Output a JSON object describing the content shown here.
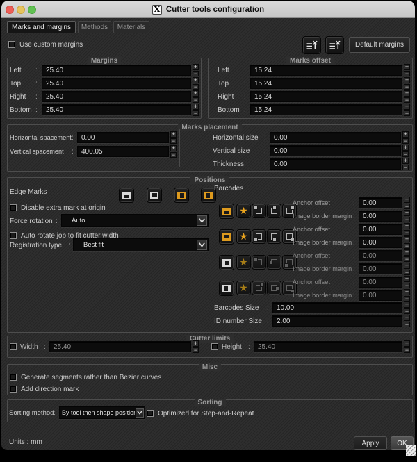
{
  "titlebar": {
    "title": "Cutter tools configuration",
    "icon_glyph": "X"
  },
  "punct": {
    "colon": ":"
  },
  "tabs": {
    "t0": "Marks and margins",
    "t1": "Methods",
    "t2": "Materials"
  },
  "top": {
    "use_custom_margins": "Use custom margins",
    "default_margins": "Default margins"
  },
  "margins": {
    "title": "Margins",
    "rows": [
      {
        "label": "Left",
        "value": "25.40"
      },
      {
        "label": "Top",
        "value": "25.40"
      },
      {
        "label": "Right",
        "value": "25.40"
      },
      {
        "label": "Bottom",
        "value": "25.40"
      }
    ]
  },
  "marks_offset": {
    "title": "Marks offset",
    "rows": [
      {
        "label": "Left",
        "value": "15.24"
      },
      {
        "label": "Top",
        "value": "15.24"
      },
      {
        "label": "Right",
        "value": "15.24"
      },
      {
        "label": "Bottom",
        "value": "15.24"
      }
    ]
  },
  "marks_placement": {
    "title": "Marks placement",
    "left_rows": [
      {
        "label": "Horizontal spacement",
        "value": "0.00"
      },
      {
        "label": "Vertical spacement",
        "value": "400.05"
      }
    ],
    "right_rows": [
      {
        "label": "Horizontal size",
        "value": "0.00"
      },
      {
        "label": "Vertical size",
        "value": "0.00"
      },
      {
        "label": "Thickness",
        "value": "0.00"
      }
    ]
  },
  "positions": {
    "title": "Positions",
    "edge_marks_label": "Edge Marks",
    "disable_extra_label": "Disable extra mark at origin",
    "force_rotation_label": "Force rotation",
    "force_rotation_value": "Auto",
    "auto_rotate_label": "Auto rotate job to fit cutter width",
    "registration_label": "Registration type",
    "registration_value": "Best fit",
    "barcodes": {
      "label": "Barcodes",
      "anchor_label": "Anchor offset",
      "border_label": "Image border margin",
      "rows": [
        {
          "anchor_value": "0.00",
          "border_value": "0.00"
        },
        {
          "anchor_value": "0.00",
          "border_value": "0.00"
        },
        {
          "anchor_value": "0.00",
          "border_value": "0.00"
        },
        {
          "anchor_value": "0.00",
          "border_value": "0.00"
        }
      ],
      "size_label": "Barcodes Size",
      "size_value": "10.00",
      "id_label": "ID number Size",
      "id_value": "2.00"
    }
  },
  "cutter_limits": {
    "title": "Cutter limits",
    "width_label": "Width",
    "width_value": "25.40",
    "height_label": "Height",
    "height_value": "25.40"
  },
  "misc": {
    "title": "Misc",
    "item0": "Generate segments rather than Bezier curves",
    "item1": "Add direction mark"
  },
  "sorting": {
    "title": "Sorting",
    "method_label": "Sorting method",
    "method_value": "By tool then shape position",
    "optimized_label": "Optimized for Step-and-Repeat"
  },
  "footer": {
    "units": "Units : mm",
    "apply": "Apply",
    "ok": "OK"
  },
  "colors": {
    "accent_orange": "#dd9a1e",
    "mark_white": "#d9d9d9",
    "star_bright": "#eaa41e",
    "star_dim": "#a87e17"
  }
}
